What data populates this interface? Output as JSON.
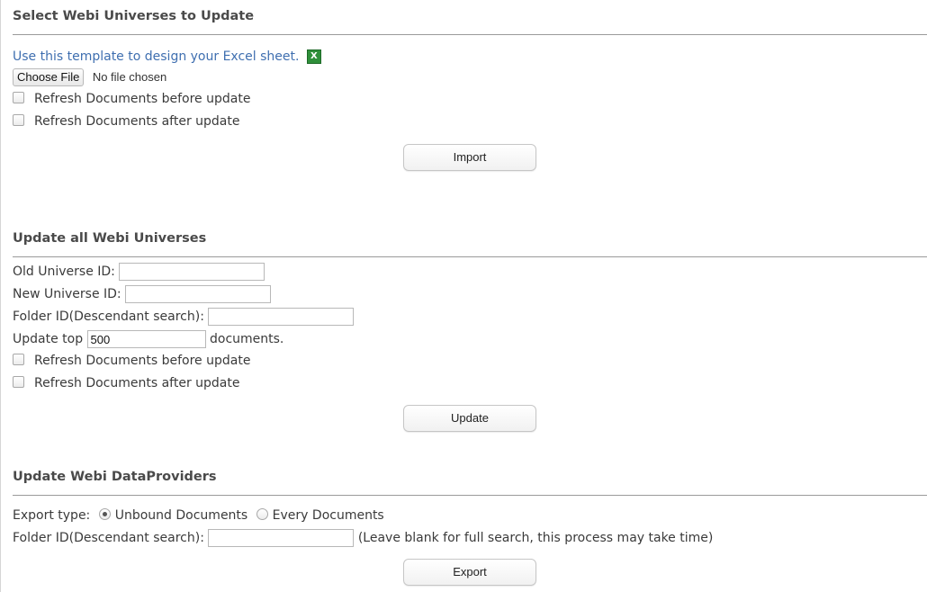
{
  "section1": {
    "title": "Select Webi Universes to Update",
    "template_link": "Use this template to design your Excel sheet.",
    "excel_icon": "excel-icon",
    "choose_file_label": "Choose File",
    "file_status": "No file chosen",
    "refresh_before": "Refresh Documents before update",
    "refresh_after": "Refresh Documents after update",
    "import_label": "Import"
  },
  "section2": {
    "title": "Update all Webi Universes",
    "old_universe_label": "Old Universe ID:",
    "old_universe_value": "",
    "new_universe_label": "New Universe ID:",
    "new_universe_value": "",
    "folder_label": "Folder ID(Descendant search):",
    "folder_value": "",
    "update_top_label": "Update top",
    "update_top_value": "500",
    "documents_suffix": "documents.",
    "refresh_before": "Refresh Documents before update",
    "refresh_after": "Refresh Documents after update",
    "update_label": "Update"
  },
  "section3": {
    "title": "Update Webi DataProviders",
    "export_type_label": "Export type:",
    "option_unbound": "Unbound Documents",
    "option_every": "Every Documents",
    "selected_option": "Unbound Documents",
    "folder_label": "Folder ID(Descendant search):",
    "folder_value": "",
    "folder_hint": "(Leave blank for full search, this process may take time)",
    "export_label": "Export"
  }
}
